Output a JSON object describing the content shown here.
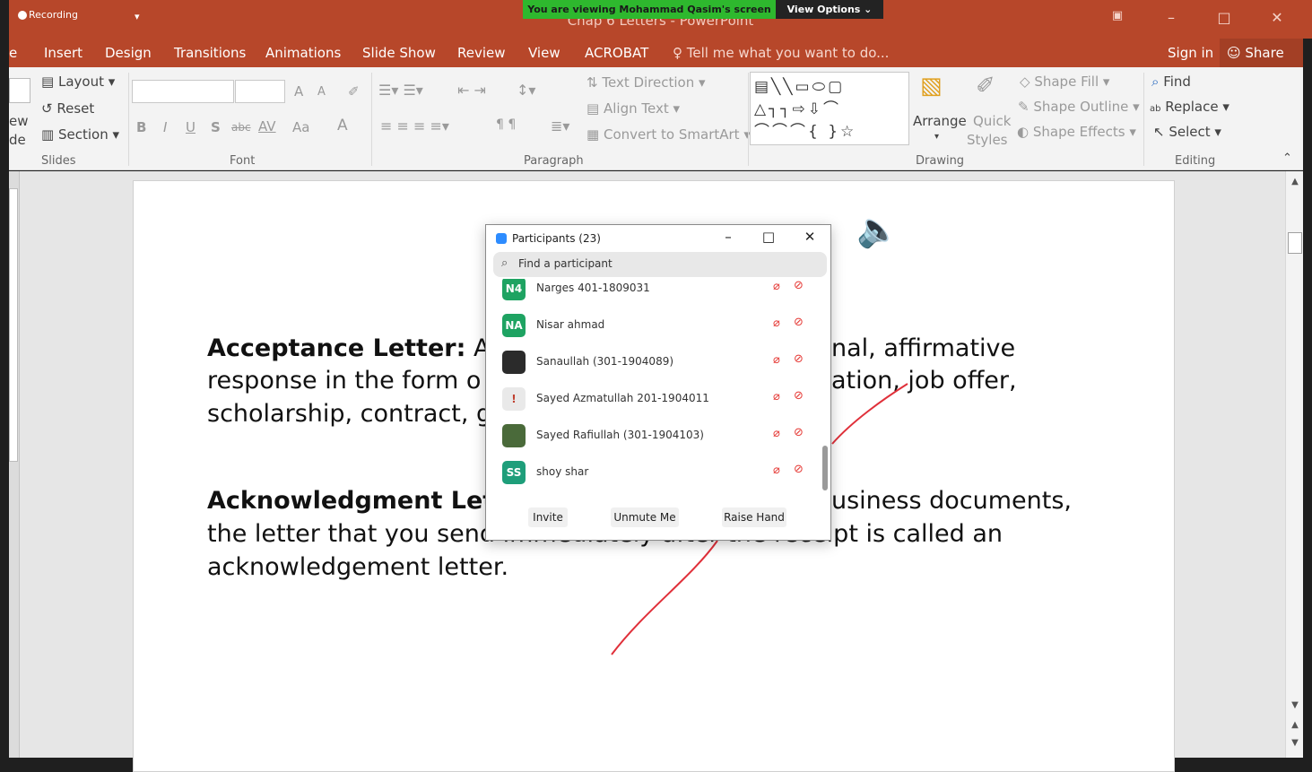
{
  "titlebar": {
    "recording": "Recording",
    "window_title": "Chap 6 Letters - PowerPoint",
    "viewing_banner": "You are viewing Mohammad Qasim's screen",
    "view_options": "View Options ⌄"
  },
  "tabs": {
    "file_stub": "e",
    "items": [
      "Insert",
      "Design",
      "Transitions",
      "Animations",
      "Slide Show",
      "Review",
      "View",
      "ACROBAT"
    ],
    "tell_me": "Tell me what you want to do...",
    "sign_in": "Sign in",
    "share": "Share"
  },
  "ribbon": {
    "slides": {
      "new_stub": "ew",
      "slide_stub": "de",
      "layout": "Layout",
      "reset": "Reset",
      "section": "Section",
      "label": "Slides"
    },
    "font": {
      "label": "Font",
      "bold": "B",
      "italic": "I",
      "underline": "U",
      "shadow": "S",
      "strike": "abc",
      "spacing": "AV",
      "case": "Aa",
      "grow": "A",
      "shrink": "A",
      "color": "A"
    },
    "paragraph": {
      "text_direction": "Text Direction",
      "align_text": "Align Text",
      "convert_smartart": "Convert to SmartArt",
      "label": "Paragraph"
    },
    "drawing": {
      "arrange": "Arrange",
      "quick_styles_1": "Quick",
      "quick_styles_2": "Styles",
      "shape_fill": "Shape Fill",
      "shape_outline": "Shape Outline",
      "shape_effects": "Shape Effects",
      "label": "Drawing"
    },
    "editing": {
      "find": "Find",
      "replace": "Replace",
      "select": "Select",
      "label": "Editing"
    }
  },
  "slide": {
    "p1_bold": "Acceptance Letter:",
    "p1_l1a": " An",
    "p1_l1b": "nal, affirmative",
    "p1_l2a": "response in the form o",
    "p1_l2b": "ation, job offer,",
    "p1_l3a": "scholarship, contract, g",
    "p2_bold": "Acknowledgment Lett",
    "p2_l1b": "usiness documents,",
    "p2_l2": "the letter that you send immediately after the receipt is called an",
    "p2_l3": "acknowledgement letter."
  },
  "participants": {
    "title": "Participants (23)",
    "search_placeholder": "Find a participant",
    "list": [
      {
        "initials": "N4",
        "name": "Narges 401-1809031",
        "color": "#1ea362"
      },
      {
        "initials": "NA",
        "name": "Nisar ahmad",
        "color": "#1ea362"
      },
      {
        "initials": "",
        "name": "Sanaullah (301-1904089)",
        "color": "#2b2b2b"
      },
      {
        "initials": "",
        "name": "Sayed Azmatullah 201-1904011",
        "color": "#e9e9e9"
      },
      {
        "initials": "",
        "name": "Sayed Rafiullah (301-1904103)",
        "color": "#4a6a3a"
      },
      {
        "initials": "SS",
        "name": "shoy shar",
        "color": "#1e9e7a"
      }
    ],
    "invite": "Invite",
    "unmute": "Unmute Me",
    "raise_hand": "Raise Hand"
  },
  "colors": {
    "accent": "#b7472a",
    "ink": "#e0303a"
  }
}
